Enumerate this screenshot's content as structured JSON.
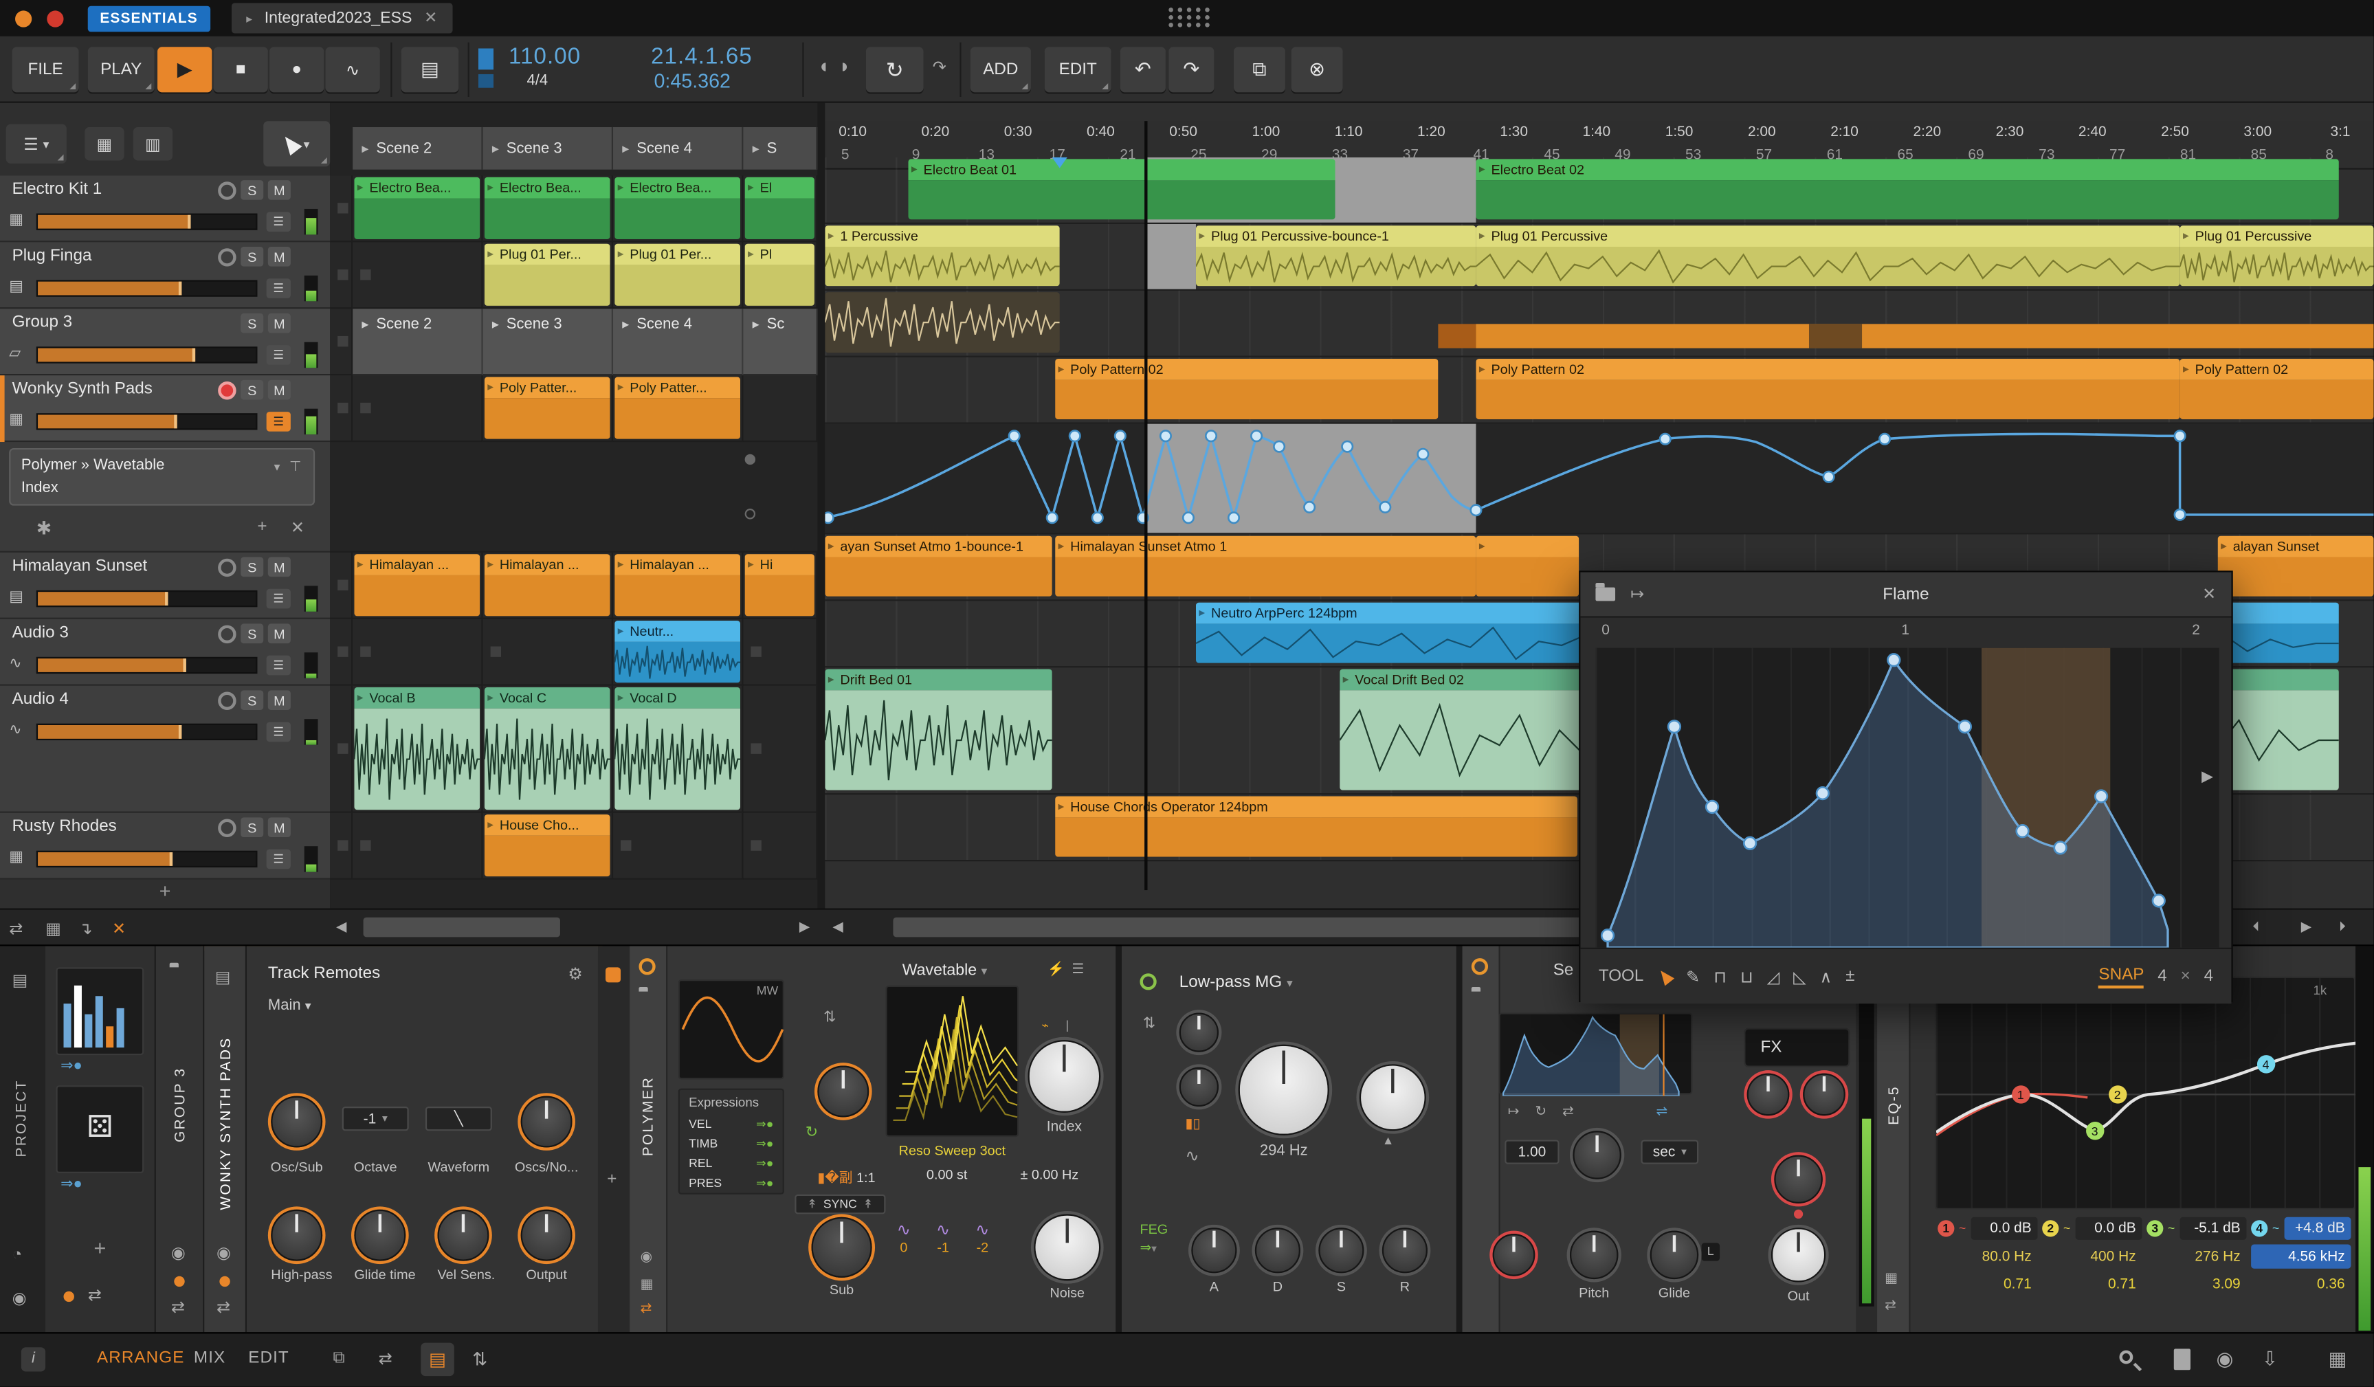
{
  "titlebar": {
    "badge": "ESSENTIALS",
    "tab": "Integrated2023_ESS"
  },
  "toolbar": {
    "file": "FILE",
    "play": "PLAY",
    "tempo": "110.00",
    "timesig": "4/4",
    "position": "21.4.1.65",
    "time": "0:45.362",
    "add": "ADD",
    "edit": "EDIT"
  },
  "icons": {
    "play": "▶",
    "stop": "■",
    "record": "●",
    "automation": "∿",
    "panel": "▤",
    "loop": "↻",
    "undo": "↶",
    "redo": "↷",
    "duplicate": "⧉",
    "delete": "⊗",
    "menu": "☰",
    "caret": "▾",
    "close": "✕",
    "plus": "+",
    "drum": "▦",
    "keys": "▤",
    "wave": "∿",
    "folder": "▱",
    "grid_view": "▦",
    "rows_view": "▥",
    "swap": "⇄",
    "down_corner": "↴",
    "pencil": "✎",
    "pin": "⊤",
    "star": "✱",
    "dice": "⚄",
    "gear": "⚙",
    "tools": [
      "⊓",
      "⊔",
      "◿",
      "◺",
      "∧",
      "±"
    ]
  },
  "launcher": {
    "solo": "S",
    "mute": "M",
    "scenes": [
      {
        "label": "Scene 2",
        "w": 86
      },
      {
        "label": "Scene 3",
        "w": 86
      },
      {
        "label": "Scene 4",
        "w": 86
      },
      {
        "label": "S",
        "w": 49
      }
    ],
    "group_scenes": [
      {
        "label": "Scene 2",
        "w": 86
      },
      {
        "label": "Scene 3",
        "w": 86
      },
      {
        "label": "Scene 4",
        "w": 86
      },
      {
        "label": "Sc",
        "w": 49
      }
    ],
    "tracks": {
      "t1": {
        "name": "Electro Kit 1",
        "c1": "Electro Bea...",
        "c2": "Electro Bea...",
        "c3": "Electro Bea...",
        "c4": "El"
      },
      "t2": {
        "name": "Plug Finga",
        "c2": "Plug 01 Per...",
        "c3": "Plug 01 Per...",
        "c4": "Pl"
      },
      "t3": {
        "name": "Group 3"
      },
      "t4": {
        "name": "Wonky Synth Pads",
        "c2": "Poly Patter...",
        "c3": "Poly Patter..."
      },
      "t5": {
        "name": "Himalayan Sunset",
        "c1": "Himalayan ...",
        "c2": "Himalayan ...",
        "c3": "Himalayan ...",
        "c4": "Hi"
      },
      "t6": {
        "name": "Audio 3",
        "c3": "Neutr..."
      },
      "t7": {
        "name": "Audio 4",
        "c1": "Vocal B",
        "c2": "Vocal C",
        "c3": "Vocal D"
      },
      "t8": {
        "name": "Rusty Rhodes",
        "c2": "House Cho..."
      }
    },
    "device_slot": {
      "line1": "Polymer » Wavetable",
      "line2": "Index"
    }
  },
  "ruler": {
    "times": [
      {
        "label": "0:10"
      },
      {
        "label": "0:20"
      },
      {
        "label": "0:30"
      },
      {
        "label": "0:40"
      },
      {
        "label": "0:50"
      },
      {
        "label": "1:00"
      },
      {
        "label": "1:10"
      },
      {
        "label": "1:20"
      },
      {
        "label": "1:30"
      },
      {
        "label": "1:40"
      },
      {
        "label": "1:50"
      },
      {
        "label": "2:00"
      },
      {
        "label": "2:10"
      },
      {
        "label": "2:20"
      },
      {
        "label": "2:30"
      },
      {
        "label": "2:40"
      },
      {
        "label": "2:50"
      },
      {
        "label": "3:00"
      },
      {
        "label": "3:1"
      }
    ],
    "bars": [
      {
        "label": "5"
      },
      {
        "label": "9"
      },
      {
        "label": "13"
      },
      {
        "label": "17"
      },
      {
        "label": "21"
      },
      {
        "label": "25"
      },
      {
        "label": "29"
      },
      {
        "label": "33"
      },
      {
        "label": "37"
      },
      {
        "label": "41"
      },
      {
        "label": "45"
      },
      {
        "label": "49"
      },
      {
        "label": "53"
      },
      {
        "label": "57"
      },
      {
        "label": "61"
      },
      {
        "label": "65"
      },
      {
        "label": "69"
      },
      {
        "label": "73"
      },
      {
        "label": "77"
      },
      {
        "label": "81"
      },
      {
        "label": "85"
      },
      {
        "label": "8"
      }
    ]
  },
  "arranger": {
    "clips": {
      "electro1": "Electro Beat 01",
      "electro2": "Electro Beat 02",
      "perc0": "1 Percussive",
      "perc1": "Plug 01 Percussive-bounce-1",
      "perc2": "Plug 01 Percussive",
      "perc3": "Plug 01 Percussive",
      "poly1": "Poly Pattern 02",
      "poly2": "Poly Pattern 02",
      "poly3": "Poly Pattern 02",
      "him0": "ayan Sunset Atmo 1-bounce-1",
      "him1": "Himalayan Sunset Atmo 1",
      "him2": "alayan Sunset",
      "neutro": "Neutro ArpPerc 124bpm",
      "drift": "Drift Bed 01",
      "vocal": "Vocal Drift Bed 02",
      "house": "House Chords Operator 124bpm"
    }
  },
  "flame": {
    "title": "Flame",
    "tool": "TOOL",
    "snap": "SNAP",
    "grid_a": "4",
    "grid_x": "×",
    "grid_b": "4",
    "r0": "0",
    "r1": "1",
    "r2": "2"
  },
  "devices": {
    "project": "PROJECT",
    "group": "GROUP 3",
    "track": "WONKY SYNTH PADS",
    "remotes": {
      "title": "Track Remotes",
      "page": "Main",
      "octave_value": "-1",
      "top": [
        {
          "label": "Osc/Sub"
        },
        {
          "label": "Octave"
        },
        {
          "label": "Waveform"
        },
        {
          "label": "Oscs/No..."
        }
      ],
      "bottom": [
        {
          "label": "High-pass"
        },
        {
          "label": "Glide time"
        },
        {
          "label": "Vel Sens."
        },
        {
          "label": "Output"
        }
      ]
    },
    "polymer": {
      "name": "POLYMER",
      "scope": "MW",
      "expr_title": "Expressions",
      "expr": [
        {
          "label": "VEL"
        },
        {
          "label": "TIMB"
        },
        {
          "label": "REL"
        },
        {
          "label": "PRES"
        }
      ],
      "sync": "SYNC",
      "wavetable": "Wavetable",
      "preset": "Reso Sweep 3oct",
      "index": "Index",
      "ratio": "1:1",
      "st": "0.00 st",
      "hz": "0.00 Hz",
      "sub": "Sub",
      "noise": "Noise",
      "octs": [
        {
          "label": "0"
        },
        {
          "label": "-1"
        },
        {
          "label": "-2"
        }
      ]
    },
    "filter": {
      "name": "Low-pass MG",
      "freq": "294 Hz",
      "feg": "FEG",
      "adsr": [
        {
          "label": "A"
        },
        {
          "label": "D"
        },
        {
          "label": "S"
        },
        {
          "label": "R"
        }
      ]
    },
    "env": {
      "header": "Se",
      "value": "1.00",
      "unit": "sec",
      "fx": "FX",
      "pitch": "Pitch",
      "glide": "Glide",
      "out": "Out"
    },
    "eq": {
      "name": "EQ-5",
      "scale": "1k",
      "bands": [
        {
          "num": "1",
          "gain": "0.0 dB",
          "freq": "80.0 Hz",
          "q": "0.71",
          "color": "#e0564a",
          "gain_bg": "#262626",
          "freq_bg": "transparent",
          "freq_color": "#e8cf52"
        },
        {
          "num": "2",
          "gain": "0.0 dB",
          "freq": "400 Hz",
          "q": "0.71",
          "color": "#e8d44d",
          "gain_bg": "#262626",
          "freq_bg": "transparent",
          "freq_color": "#e8cf52"
        },
        {
          "num": "3",
          "gain": "-5.1 dB",
          "freq": "276 Hz",
          "q": "3.09",
          "color": "#a5e063",
          "gain_bg": "#262626",
          "freq_bg": "transparent",
          "freq_color": "#e8cf52"
        },
        {
          "num": "4",
          "gain": "+4.8 dB",
          "freq": "4.56 kHz",
          "q": "0.36",
          "color": "#74d7ee",
          "gain_bg": "#2e66b5",
          "freq_bg": "#2e66b5",
          "freq_color": "#ffffff"
        }
      ]
    }
  },
  "statusbar": {
    "arrange": "ARRANGE",
    "mix": "MIX",
    "edit": "EDIT"
  }
}
